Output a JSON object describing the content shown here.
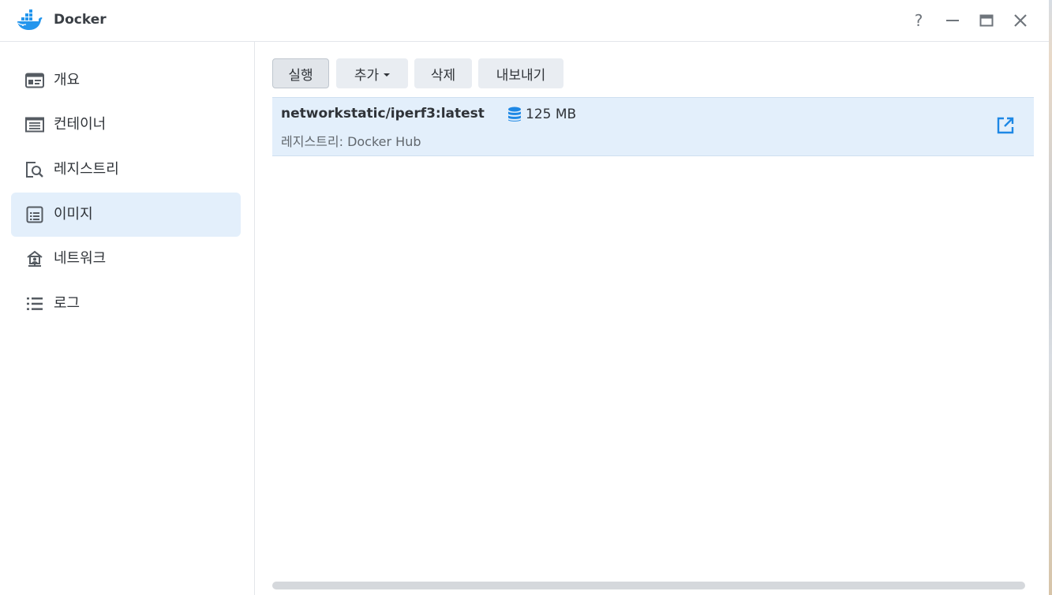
{
  "window": {
    "title": "Docker",
    "controls": {
      "help": "?",
      "minimize_icon": "minimize-icon",
      "maximize_icon": "maximize-icon",
      "close_icon": "close-icon"
    }
  },
  "sidebar": {
    "items": [
      {
        "label": "개요",
        "icon": "overview-icon",
        "active": false
      },
      {
        "label": "컨테이너",
        "icon": "container-icon",
        "active": false
      },
      {
        "label": "레지스트리",
        "icon": "registry-search-icon",
        "active": false
      },
      {
        "label": "이미지",
        "icon": "image-icon",
        "active": true
      },
      {
        "label": "네트워크",
        "icon": "network-icon",
        "active": false
      },
      {
        "label": "로그",
        "icon": "log-list-icon",
        "active": false
      }
    ]
  },
  "toolbar": {
    "run_label": "실행",
    "add_label": "추가",
    "delete_label": "삭제",
    "export_label": "내보내기"
  },
  "images": [
    {
      "name": "networkstatic/iperf3:latest",
      "size": "125 MB",
      "registry": "레지스트리: Docker Hub"
    }
  ],
  "colors": {
    "accent": "#1e88e5",
    "selected_bg": "#e3effb",
    "button_bg": "#e9edf2"
  }
}
